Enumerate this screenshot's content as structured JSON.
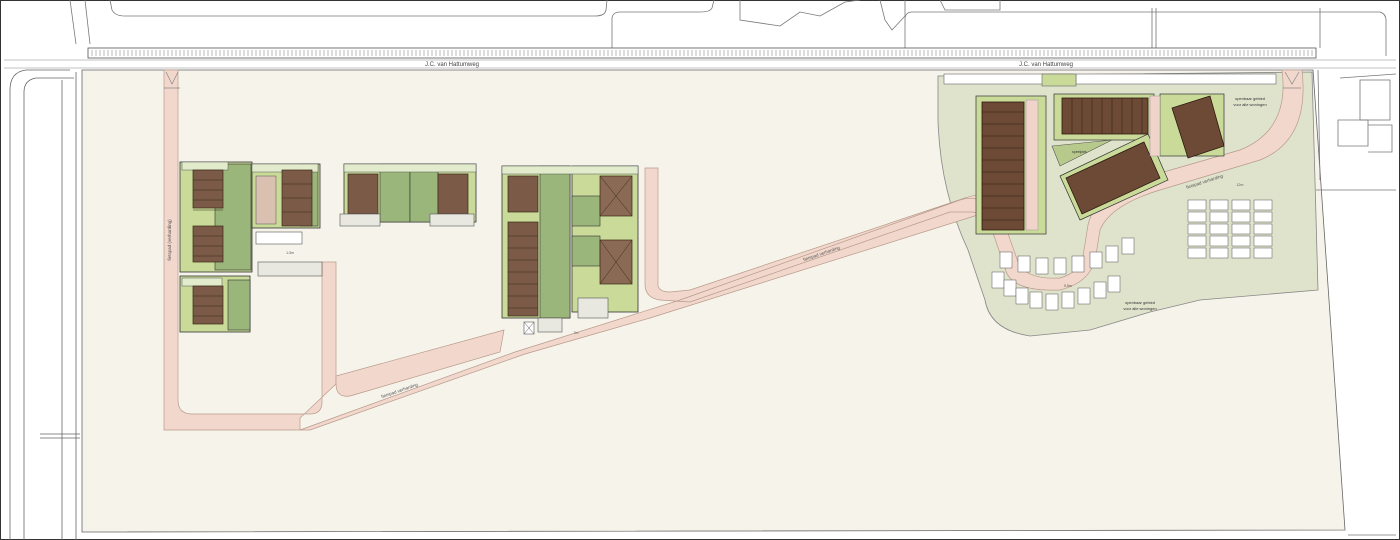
{
  "roads": {
    "north_road_left": "J.C. van Hattumweg",
    "north_road_right": "J.C. van Hattumweg",
    "path_west_vertical": "fietspad (verharding)",
    "path_diagonal_lower": "fietspad verharding",
    "path_diagonal_upper": "fietspad verharding",
    "path_east_curve": "fietspad verharding",
    "parking_label_a": "1:3m",
    "parking_label_b": "7m",
    "parking_label_c": "5,5m",
    "parking_label_d": "12m"
  },
  "notes": {
    "open_green_north": "openbaar gebied\nvoor alle woningen",
    "open_green_south": "openbaar gebied\nvoor alle woningen",
    "speelplek": "speelplek"
  },
  "colors": {
    "field": "#f6f3ea",
    "green_area": "#dfe3cc",
    "path": "#f2d8cc",
    "garden_light": "#cadb99",
    "garden_dark": "#9bb67a",
    "roof": "#7b5b48",
    "roof_dark": "#5a3c2a",
    "paving": "#f0d3c9"
  }
}
